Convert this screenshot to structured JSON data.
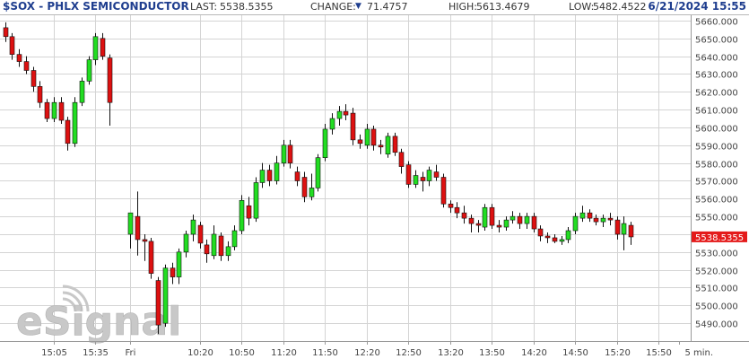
{
  "header": {
    "symbol": "$SOX - PHLX SEMICONDUCTOR",
    "last_label": "LAST:",
    "last_value": "5538.5355",
    "change_label": "CHANGE:",
    "change_value": "71.4757",
    "high_label": "HIGH:",
    "high_value": "5613.4679",
    "low_label": "LOW:",
    "low_value": "5482.4522",
    "datetime": "6/21/2024 15:55"
  },
  "watermark": "eSignal",
  "colors": {
    "up": "#22dd22",
    "down": "#dd1111",
    "wick": "#111111",
    "grid": "#d4d4d4",
    "header_text": "#1f3e8f",
    "price_tag": "#e41a1a"
  },
  "chart_data": {
    "type": "candlestick",
    "ylim": [
      5480,
      5663
    ],
    "y_ticks": [
      5490,
      5500,
      5510,
      5520,
      5530,
      5540,
      5550,
      5560,
      5570,
      5580,
      5590,
      5600,
      5610,
      5620,
      5630,
      5640,
      5650,
      5660
    ],
    "x_ticks": [
      {
        "i": 7,
        "label": "15:05"
      },
      {
        "i": 13,
        "label": "15:35"
      },
      {
        "i": 18,
        "label": "Fri"
      },
      {
        "i": 28,
        "label": "10:20"
      },
      {
        "i": 34,
        "label": "10:50"
      },
      {
        "i": 40,
        "label": "11:20"
      },
      {
        "i": 46,
        "label": "11:50"
      },
      {
        "i": 52,
        "label": "12:20"
      },
      {
        "i": 58,
        "label": "12:50"
      },
      {
        "i": 64,
        "label": "13:20"
      },
      {
        "i": 70,
        "label": "13:50"
      },
      {
        "i": 76,
        "label": "14:20"
      },
      {
        "i": 82,
        "label": "14:50"
      },
      {
        "i": 88,
        "label": "15:20"
      },
      {
        "i": 94,
        "label": "15:50"
      },
      {
        "i": 97,
        "label": "5 min."
      }
    ],
    "last_price": "5538.5355",
    "last_value": 5538.5355,
    "candles": [
      [
        5656,
        5659,
        5648,
        5651
      ],
      [
        5651,
        5653,
        5638,
        5641
      ],
      [
        5641,
        5644,
        5634,
        5637
      ],
      [
        5637,
        5640,
        5630,
        5632
      ],
      [
        5632,
        5634,
        5620,
        5623
      ],
      [
        5623,
        5626,
        5611,
        5614
      ],
      [
        5614,
        5616,
        5603,
        5605
      ],
      [
        5605,
        5617,
        5603,
        5614
      ],
      [
        5614,
        5617,
        5602,
        5604
      ],
      [
        5604,
        5606,
        5587,
        5591
      ],
      [
        5591,
        5617,
        5589,
        5614
      ],
      [
        5614,
        5628,
        5612,
        5626
      ],
      [
        5626,
        5640,
        5624,
        5638
      ],
      [
        5638,
        5653,
        5635,
        5651
      ],
      [
        5650,
        5653,
        5638,
        5640
      ],
      [
        5639,
        5641,
        5601,
        5614
      ],
      [],
      [],
      [
        5540,
        5552,
        5532,
        5552
      ],
      [
        5550,
        5564,
        5528,
        5537
      ],
      [
        5537,
        5540,
        5525,
        5536
      ],
      [
        5536,
        5538,
        5515,
        5518
      ],
      [
        5514,
        5516,
        5484,
        5489
      ],
      [
        5490,
        5523,
        5488,
        5521
      ],
      [
        5521,
        5524,
        5512,
        5516
      ],
      [
        5516,
        5532,
        5512,
        5530
      ],
      [
        5530,
        5542,
        5527,
        5540
      ],
      [
        5540,
        5551,
        5536,
        5548
      ],
      [
        5545,
        5547,
        5532,
        5535
      ],
      [
        5534,
        5537,
        5524,
        5529
      ],
      [
        5528,
        5545,
        5526,
        5540
      ],
      [
        5539,
        5541,
        5525,
        5528
      ],
      [
        5528,
        5536,
        5525,
        5533
      ],
      [
        5533,
        5545,
        5531,
        5542
      ],
      [
        5542,
        5562,
        5540,
        5559
      ],
      [
        5556,
        5561,
        5545,
        5549
      ],
      [
        5549,
        5572,
        5547,
        5569
      ],
      [
        5569,
        5580,
        5566,
        5576
      ],
      [
        5576,
        5579,
        5567,
        5570
      ],
      [
        5570,
        5584,
        5568,
        5580
      ],
      [
        5580,
        5593,
        5578,
        5590
      ],
      [
        5590,
        5593,
        5577,
        5580
      ],
      [
        5575,
        5578,
        5567,
        5570
      ],
      [
        5572,
        5575,
        5558,
        5561
      ],
      [
        5561,
        5574,
        5559,
        5566
      ],
      [
        5566,
        5585,
        5564,
        5583
      ],
      [
        5583,
        5602,
        5581,
        5599
      ],
      [
        5599,
        5608,
        5596,
        5605
      ],
      [
        5605,
        5612,
        5601,
        5609
      ],
      [
        5609,
        5613,
        5604,
        5607
      ],
      [
        5608,
        5611,
        5590,
        5593
      ],
      [
        5593,
        5596,
        5588,
        5591
      ],
      [
        5590,
        5602,
        5588,
        5599
      ],
      [
        5599,
        5601,
        5587,
        5590
      ],
      [
        5590,
        5593,
        5585,
        5589
      ],
      [
        5585,
        5597,
        5583,
        5595
      ],
      [
        5595,
        5597,
        5584,
        5586
      ],
      [
        5586,
        5588,
        5574,
        5578
      ],
      [
        5579,
        5581,
        5566,
        5568
      ],
      [
        5568,
        5576,
        5566,
        5573
      ],
      [
        5572,
        5575,
        5564,
        5570
      ],
      [
        5570,
        5578,
        5567,
        5576
      ],
      [
        5575,
        5579,
        5570,
        5572
      ],
      [
        5572,
        5574,
        5555,
        5557
      ],
      [
        5557,
        5559,
        5552,
        5555
      ],
      [
        5555,
        5558,
        5549,
        5552
      ],
      [
        5552,
        5556,
        5546,
        5549
      ],
      [
        5549,
        5551,
        5541,
        5546
      ],
      [
        5546,
        5548,
        5541,
        5545
      ],
      [
        5544,
        5557,
        5542,
        5555
      ],
      [
        5555,
        5557,
        5543,
        5545
      ],
      [
        5545,
        5548,
        5541,
        5544
      ],
      [
        5544,
        5550,
        5542,
        5548
      ],
      [
        5548,
        5553,
        5546,
        5550
      ],
      [
        5550,
        5552,
        5543,
        5546
      ],
      [
        5546,
        5552,
        5543,
        5550
      ],
      [
        5550,
        5552,
        5541,
        5543
      ],
      [
        5543,
        5545,
        5536,
        5539
      ],
      [
        5539,
        5541,
        5535,
        5538
      ],
      [
        5538,
        5540,
        5535,
        5536
      ],
      [
        5536,
        5539,
        5534,
        5537
      ],
      [
        5537,
        5544,
        5535,
        5542
      ],
      [
        5542,
        5552,
        5540,
        5550
      ],
      [
        5549,
        5556,
        5547,
        5552
      ],
      [
        5552,
        5554,
        5547,
        5549
      ],
      [
        5549,
        5551,
        5545,
        5547
      ],
      [
        5547,
        5551,
        5544,
        5549
      ],
      [
        5549,
        5552,
        5545,
        5548
      ],
      [
        5548,
        5550,
        5537,
        5540
      ],
      [
        5540,
        5550,
        5531,
        5546
      ],
      [
        5545,
        5547,
        5534,
        5538.5
      ]
    ]
  }
}
